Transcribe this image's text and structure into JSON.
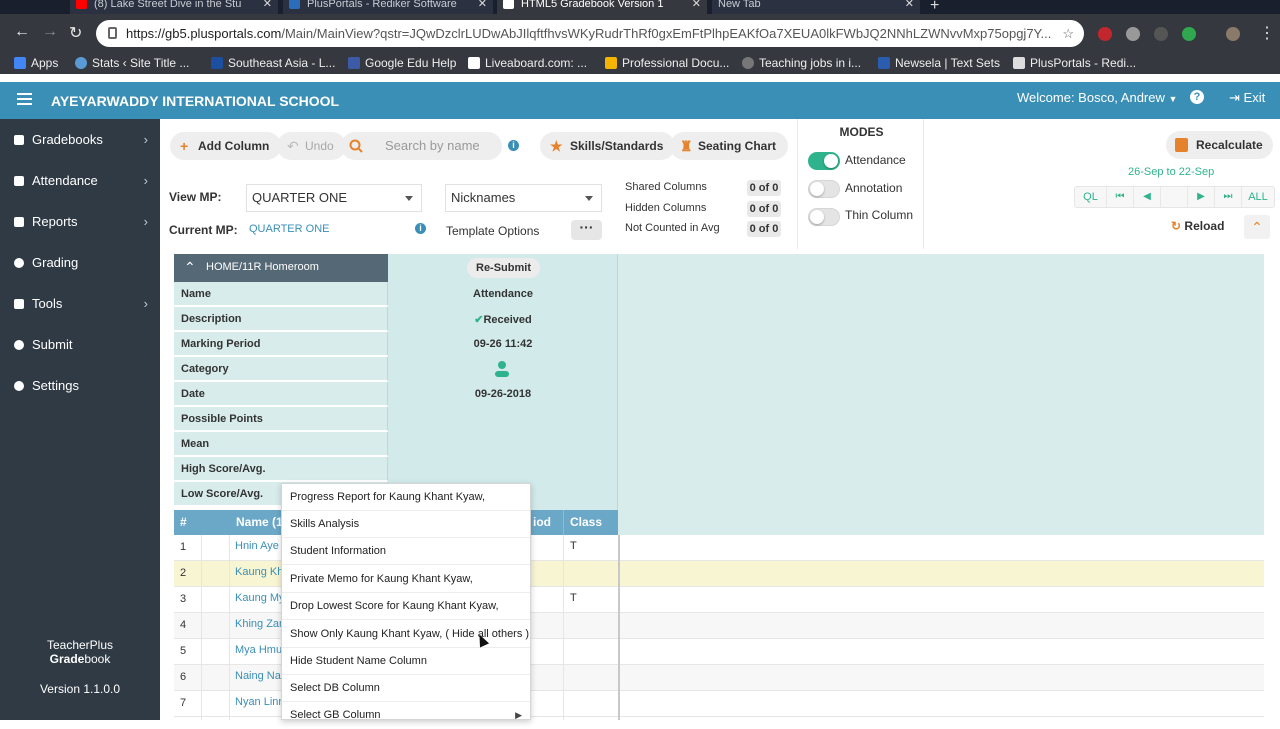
{
  "browser": {
    "tabs": [
      {
        "title": "(8) Lake Street Dive in the Stu",
        "icon": "youtube-icon",
        "color": "#ff0000"
      },
      {
        "title": "PlusPortals - Rediker Software",
        "icon": "plusportals-icon",
        "color": "#2a6ebb"
      },
      {
        "title": "HTML5 Gradebook Version 1",
        "icon": "gradebook-tab-icon",
        "color": "#1f1f1f"
      },
      {
        "title": "New Tab",
        "icon": "",
        "color": ""
      }
    ],
    "url_host": "https://gb5.plusportals.com",
    "url_path": "/Main/MainView?qstr=JQwDzclrLUDwAbJIlqftfhvsWKyRudrThRf0gxEmFtPlhpEAKfOa7XEUA0lkFWbJQ2NNhLZWNvvMxp75opgj7Y...",
    "bookmarks": [
      "Apps",
      "Stats ‹ Site Title ...",
      "Southeast Asia - L...",
      "Google Edu Help",
      "Liveaboard.com: ...",
      "Professional Docu...",
      "Teaching jobs in i...",
      "Newsela | Text Sets",
      "PlusPortals - Redi..."
    ]
  },
  "header": {
    "school": "AYEYARWADDY INTERNATIONAL SCHOOL",
    "welcome": "Welcome: Bosco, Andrew",
    "exit": "Exit"
  },
  "sidebar": {
    "items": [
      {
        "label": "Gradebooks",
        "icon": "book-icon",
        "has_children": true
      },
      {
        "label": "Attendance",
        "icon": "attendance-icon",
        "has_children": true
      },
      {
        "label": "Reports",
        "icon": "report-icon",
        "has_children": true
      },
      {
        "label": "Grading",
        "icon": "grading-icon",
        "has_children": false
      },
      {
        "label": "Tools",
        "icon": "wrench-icon",
        "has_children": true
      },
      {
        "label": "Submit",
        "icon": "check-circle-icon",
        "has_children": false
      },
      {
        "label": "Settings",
        "icon": "gear-icon",
        "has_children": false
      }
    ],
    "brand_top": "TeacherPlus",
    "brand_main_a": "Grade",
    "brand_main_b": "book",
    "version": "Version 1.1.0.0"
  },
  "toolbar": {
    "add_column": "Add Column",
    "undo": "Undo",
    "search_placeholder": "Search by name",
    "skills": "Skills/Standards",
    "seating": "Seating Chart",
    "view_mp_label": "View MP:",
    "view_mp_value": "QUARTER ONE",
    "current_mp_label": "Current MP:",
    "current_mp_value": "QUARTER ONE",
    "name_mode": "Nicknames",
    "template_options": "Template Options",
    "counts": [
      {
        "label": "Shared Columns",
        "value": "0 of 0"
      },
      {
        "label": "Hidden Columns",
        "value": "0 of 0"
      },
      {
        "label": "Not Counted in Avg",
        "value": "0 of 0"
      }
    ],
    "modes_title": "MODES",
    "modes": [
      {
        "label": "Attendance",
        "on": true
      },
      {
        "label": "Annotation",
        "on": false
      },
      {
        "label": "Thin Column",
        "on": false
      }
    ],
    "recalculate": "Recalculate",
    "date_range": "26-Sep to 22-Sep",
    "mp_nav": [
      "QL",
      "⏮",
      "◀",
      "",
      "▶",
      "⏭",
      "ALL"
    ],
    "reload": "Reload"
  },
  "assignment": {
    "header": "HOME/11R Homeroom",
    "fields": [
      "Name",
      "Description",
      "Marking Period",
      "Category",
      "Date",
      "Possible Points",
      "Mean",
      "High Score/Avg.",
      "Low Score/Avg."
    ],
    "resubmit": "Re-Submit",
    "name_value": "Attendance",
    "status": "Received",
    "marking_period_value": "09-26 11:42",
    "date_value": "09-26-2018"
  },
  "table": {
    "headers": {
      "num": "#",
      "name": "Name (1",
      "period": "iod",
      "class": "Class"
    },
    "rows": [
      {
        "num": "1",
        "name": "Hnin Aye",
        "class": "T"
      },
      {
        "num": "2",
        "name": "Kaung Kh",
        "class": ""
      },
      {
        "num": "3",
        "name": "Kaung My",
        "class": "T"
      },
      {
        "num": "4",
        "name": "Khing Zar",
        "class": ""
      },
      {
        "num": "5",
        "name": "Mya Hmu",
        "class": ""
      },
      {
        "num": "6",
        "name": "Naing Na",
        "class": ""
      },
      {
        "num": "7",
        "name": "Nyan Linn",
        "class": ""
      }
    ]
  },
  "context_menu": {
    "items": [
      {
        "label": "Progress Report for Kaung Khant Kyaw,",
        "sub": false
      },
      {
        "label": "Skills Analysis",
        "sub": false
      },
      {
        "label": "Student Information",
        "sub": false
      },
      {
        "label": "Private Memo for Kaung Khant Kyaw,",
        "sub": false
      },
      {
        "label": "Drop Lowest Score for Kaung Khant Kyaw,",
        "sub": false
      },
      {
        "label": "Show Only Kaung Khant Kyaw, ( Hide all others )",
        "sub": false
      },
      {
        "label": "Hide Student Name Column",
        "sub": false
      },
      {
        "label": "Select DB Column",
        "sub": false
      },
      {
        "label": "Select GB Column",
        "sub": true
      }
    ]
  },
  "colors": {
    "accent": "#3a8fb7",
    "sidebar": "#2f3a45",
    "orange": "#e7822c",
    "green": "#2fb38c"
  }
}
